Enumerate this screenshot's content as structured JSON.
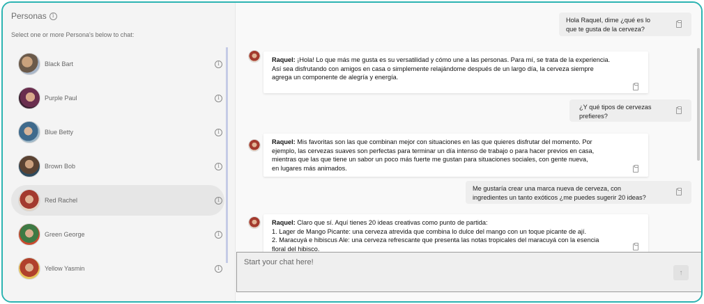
{
  "sidebar": {
    "title": "Personas",
    "subtitle": "Select one or more Persona's below to chat:",
    "personas": [
      {
        "name": "Black Bart",
        "active": false
      },
      {
        "name": "Purple Paul",
        "active": false
      },
      {
        "name": "Blue Betty",
        "active": false
      },
      {
        "name": "Brown Bob",
        "active": false
      },
      {
        "name": "Red Rachel",
        "active": true
      },
      {
        "name": "Green George",
        "active": false
      },
      {
        "name": "Yellow Yasmin",
        "active": false
      }
    ]
  },
  "chat": {
    "messages": [
      {
        "role": "user",
        "lines": [
          "Hola Raquel, dime ¿qué es lo",
          "que te gusta de la cerveza?"
        ]
      },
      {
        "role": "bot",
        "speaker": "Raquel:",
        "lines": [
          "¡Hola! Lo que más me gusta es su versatilidad y cómo une a las personas. Para mí, se trata de la experiencia.",
          "Así sea disfrutando con amigos en casa o simplemente relajándome después de un largo día, la cerveza siempre",
          "agrega un componente de alegría y energía."
        ]
      },
      {
        "role": "user",
        "lines": [
          "¿Y qué tipos de cervezas",
          "prefieres?"
        ]
      },
      {
        "role": "bot",
        "speaker": "Raquel:",
        "lines": [
          "Mis favoritas son las que combinan mejor con situaciones en las que quieres disfrutar del momento. Por",
          "ejemplo, las cervezas suaves son perfectas para terminar un día intenso de trabajo o para hacer previos en casa,",
          "mientras que las que tiene un sabor un poco más fuerte me gustan para situaciones sociales, con gente nueva,",
          "en lugares más animados."
        ]
      },
      {
        "role": "user",
        "lines": [
          "Me gustaría crear una marca nueva de cerveza, con",
          "ingredientes un tanto exóticos ¿me puedes sugerir 20 ideas?"
        ]
      },
      {
        "role": "bot",
        "speaker": "Raquel:",
        "lines": [
          "Claro que sí. Aquí tienes 20 ideas creativas como punto de partida:",
          "1. Lager de Mango Picante: una cerveza atrevida que combina lo dulce del mango con un toque picante de ají.",
          "2. Maracuyá e hibiscus Ale: una cerveza refrescante que presenta las notas tropicales del maracuyá con la esencia",
          "floral del hibisco."
        ]
      }
    ],
    "input_placeholder": "Start your chat here!"
  },
  "colors": {
    "frame": "#2bb3b1",
    "scroll_thumb": "#c5cbe6"
  }
}
